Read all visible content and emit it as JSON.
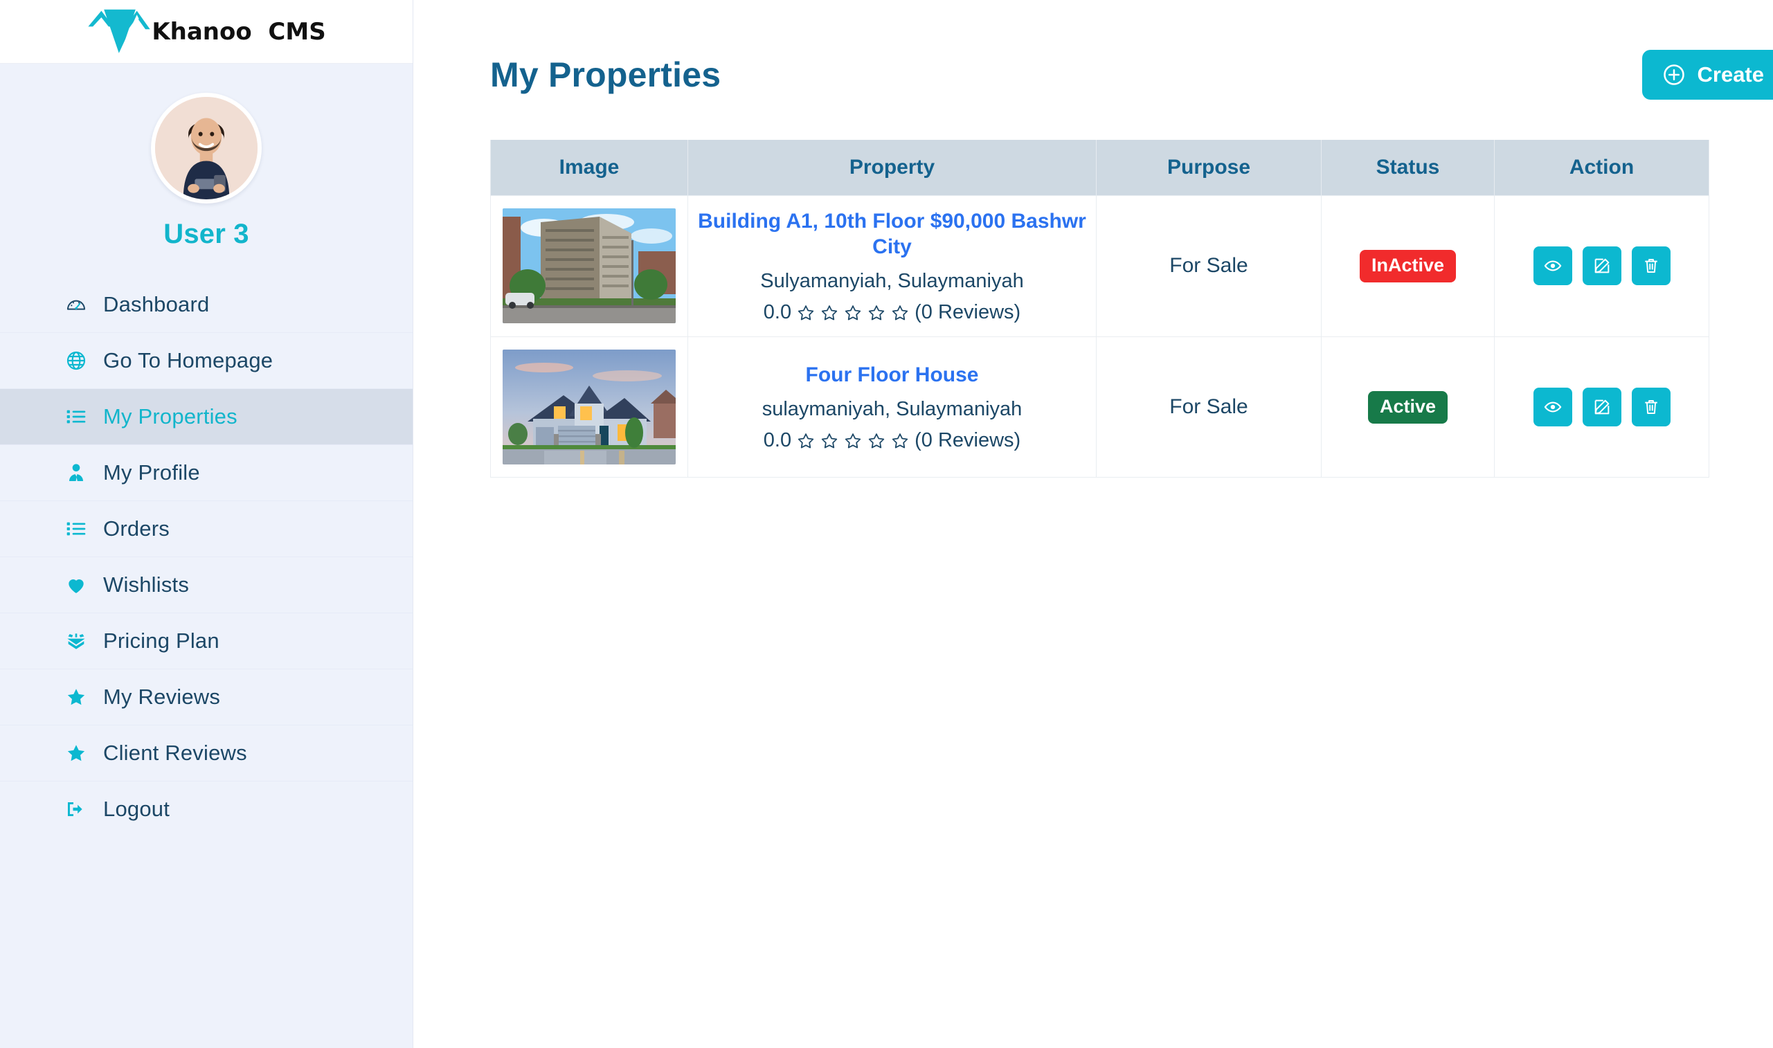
{
  "brand": {
    "name": "Khanoo  CMS",
    "logo_icon": "khanoo-mountain-logo"
  },
  "sidebar": {
    "profile": {
      "avatar_icon": "user-avatar-photo",
      "username": "User 3"
    },
    "items": [
      {
        "label": "Dashboard",
        "icon": "dashboard-gauge-icon",
        "active": false
      },
      {
        "label": "Go To Homepage",
        "icon": "globe-icon",
        "active": false
      },
      {
        "label": "My Properties",
        "icon": "list-icon",
        "active": true
      },
      {
        "label": "My Profile",
        "icon": "user-tie-icon",
        "active": false
      },
      {
        "label": "Orders",
        "icon": "list-icon",
        "active": false
      },
      {
        "label": "Wishlists",
        "icon": "heart-icon",
        "active": false
      },
      {
        "label": "Pricing Plan",
        "icon": "open-box-icon",
        "active": false
      },
      {
        "label": "My Reviews",
        "icon": "star-icon",
        "active": false
      },
      {
        "label": "Client Reviews",
        "icon": "star-icon",
        "active": false
      },
      {
        "label": "Logout",
        "icon": "logout-icon",
        "active": false
      }
    ]
  },
  "main": {
    "page_title": "My Properties",
    "create_button": {
      "label": "Create",
      "icon": "plus-circle-icon"
    },
    "table": {
      "columns": [
        "Image",
        "Property",
        "Purpose",
        "Status",
        "Action"
      ],
      "rows": [
        {
          "image_icon": "apartment-building-photo",
          "title": "Building A1, 10th Floor $90,000 Bashwr City",
          "address": "Sulyamanyiah, Sulaymaniyah",
          "rating_value": "0.0",
          "stars_filled": 0,
          "stars_total": 5,
          "reviews_text": "(0 Reviews)",
          "purpose": "For Sale",
          "status": "InActive",
          "status_type": "inactive",
          "actions": [
            {
              "name": "view",
              "icon": "eye-icon"
            },
            {
              "name": "edit",
              "icon": "pencil-square-icon"
            },
            {
              "name": "delete",
              "icon": "trash-icon"
            }
          ]
        },
        {
          "image_icon": "suburban-house-photo",
          "title": "Four Floor House",
          "address": "sulaymaniyah, Sulaymaniyah",
          "rating_value": "0.0",
          "stars_filled": 0,
          "stars_total": 5,
          "reviews_text": "(0 Reviews)",
          "purpose": "For Sale",
          "status": "Active",
          "status_type": "active",
          "actions": [
            {
              "name": "view",
              "icon": "eye-icon"
            },
            {
              "name": "edit",
              "icon": "pencil-square-icon"
            },
            {
              "name": "delete",
              "icon": "trash-icon"
            }
          ]
        }
      ]
    }
  },
  "colors": {
    "accent_cyan": "#0cb8d0",
    "title_blue": "#14628e",
    "link_blue": "#2b72f0",
    "status_active_green": "#177a49",
    "status_inactive_red": "#f12b2c",
    "sidebar_bg": "#eef2fb",
    "sidebar_active_bg": "#d6dde9",
    "table_header_bg": "#ced9e2"
  }
}
